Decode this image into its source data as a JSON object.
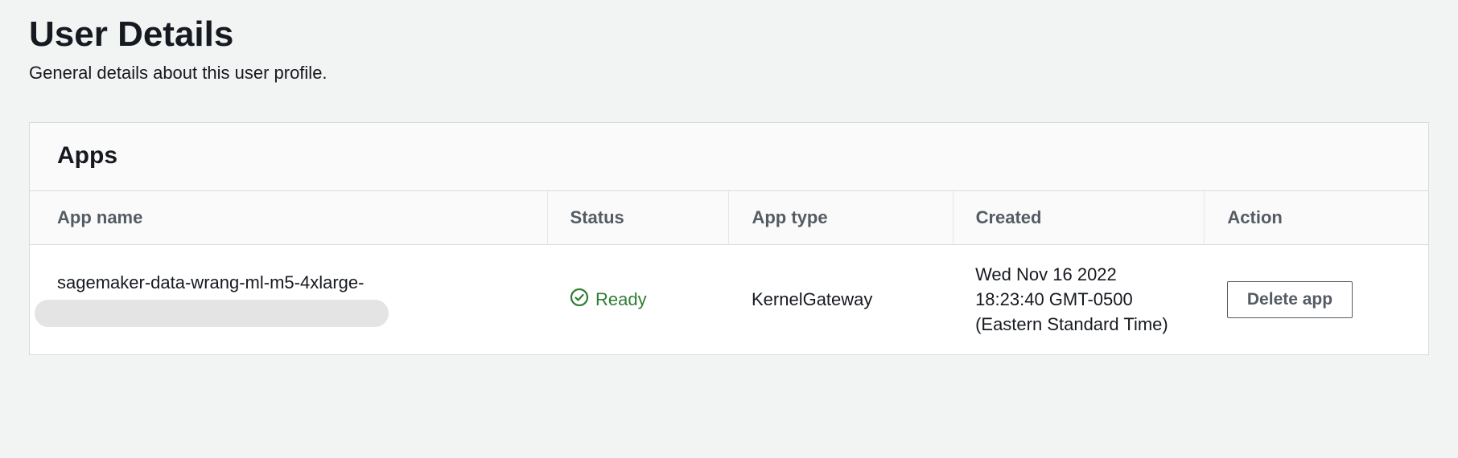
{
  "header": {
    "title": "User Details",
    "subtitle": "General details about this user profile."
  },
  "panel": {
    "title": "Apps",
    "columns": {
      "app_name": "App name",
      "status": "Status",
      "app_type": "App type",
      "created": "Created",
      "action": "Action"
    },
    "rows": [
      {
        "app_name": "sagemaker-data-wrang-ml-m5-4xlarge-",
        "status": "Ready",
        "status_color": "#2e7d32",
        "app_type": "KernelGateway",
        "created": "Wed Nov 16 2022 18:23:40 GMT-0500 (Eastern Standard Time)",
        "action_label": "Delete app"
      }
    ]
  }
}
